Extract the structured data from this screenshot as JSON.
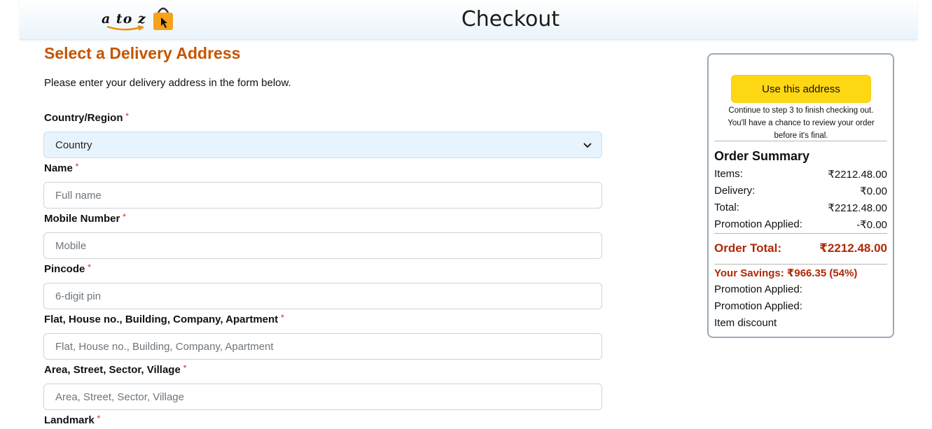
{
  "header": {
    "logo_text": "a to z",
    "title": "Checkout"
  },
  "form": {
    "section_title": "Select a Delivery Address",
    "intro": "Please enter your delivery address in the form below.",
    "required_mark": "*",
    "country": {
      "label": "Country/Region",
      "value": "Country"
    },
    "name": {
      "label": "Name",
      "placeholder": "Full name"
    },
    "mobile": {
      "label": "Mobile Number",
      "placeholder": "Mobile"
    },
    "pincode": {
      "label": "Pincode",
      "placeholder": "6-digit pin"
    },
    "flat": {
      "label": "Flat, House no., Building, Company, Apartment",
      "placeholder": "Flat, House no., Building, Company, Apartment"
    },
    "area": {
      "label": "Area, Street, Sector, Village",
      "placeholder": "Area, Street, Sector, Village"
    },
    "landmark": {
      "label": "Landmark"
    }
  },
  "summary": {
    "use_address_label": "Use this address",
    "continue_note": "Continue to step 3 to finish checking out. You'll have a chance to review your order before it's final.",
    "title": "Order Summary",
    "items_label": "Items:",
    "items_value": "₹2212.48.00",
    "delivery_label": "Delivery:",
    "delivery_value": "₹0.00",
    "total_label": "Total:",
    "total_value": "₹2212.48.00",
    "promo_label": "Promotion Applied:",
    "promo_value": "-₹0.00",
    "order_total_label": "Order Total:",
    "order_total_value": "₹2212.48.00",
    "savings": "Your Savings: ₹966.35 (54%)",
    "promo_line_1": "Promotion Applied:",
    "promo_line_2": "Promotion Applied:",
    "item_discount": "Item discount"
  },
  "colors": {
    "accent": "#c45500",
    "button": "#ffd814",
    "price_red": "#b12704"
  }
}
